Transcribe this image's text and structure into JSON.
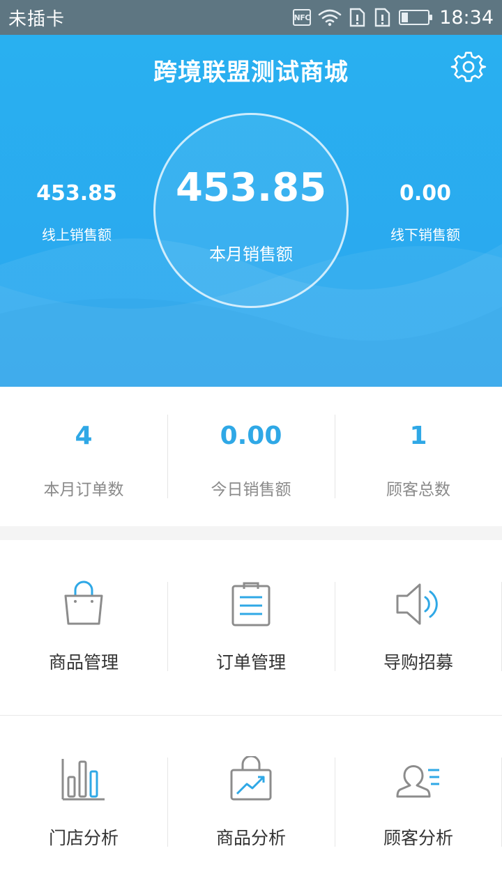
{
  "status_bar": {
    "carrier": "未插卡",
    "nfc": "NFC",
    "time": "18:34"
  },
  "header": {
    "title": "跨境联盟测试商城",
    "month_sales_value": "453.85",
    "month_sales_label": "本月销售额",
    "online_value": "453.85",
    "online_label": "线上销售额",
    "offline_value": "0.00",
    "offline_label": "线下销售额"
  },
  "stats": [
    {
      "value": "4",
      "label": "本月订单数"
    },
    {
      "value": "0.00",
      "label": "今日销售额"
    },
    {
      "value": "1",
      "label": "顾客总数"
    }
  ],
  "menu": [
    {
      "label": "商品管理",
      "icon": "shopping-bag-icon"
    },
    {
      "label": "订单管理",
      "icon": "clipboard-icon"
    },
    {
      "label": "导购招募",
      "icon": "speaker-icon"
    },
    {
      "label": "门店分析",
      "icon": "bar-chart-icon"
    },
    {
      "label": "商品分析",
      "icon": "trend-bag-icon"
    },
    {
      "label": "顾客分析",
      "icon": "user-list-icon"
    }
  ],
  "colors": {
    "header_bg": "#29b0f0",
    "accent": "#2fa8e6",
    "status_bar": "#5e7682"
  }
}
